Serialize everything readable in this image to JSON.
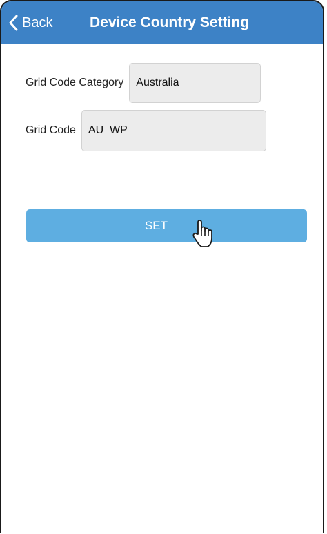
{
  "nav": {
    "back_label": "Back",
    "title": "Device Country Setting"
  },
  "form": {
    "grid_code_category": {
      "label": "Grid Code Category",
      "value": "Australia"
    },
    "grid_code": {
      "label": "Grid Code",
      "value": "AU_WP"
    }
  },
  "actions": {
    "set_label": "SET"
  },
  "colors": {
    "nav_bar": "#3d82c6",
    "button": "#5eaee1",
    "field_bg": "#ececec"
  },
  "icons": {
    "back": "chevron-left-icon",
    "pointer": "hand-pointer-icon"
  }
}
